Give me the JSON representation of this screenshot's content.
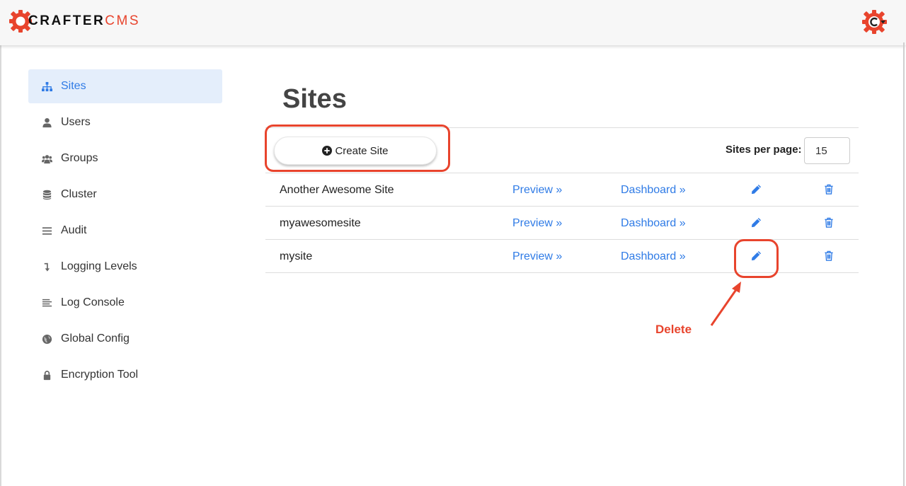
{
  "app": {
    "logo_text_a": "CRAFTER",
    "logo_text_b": "CMS",
    "brand_color": "#e8442d",
    "accent_color": "#2f7be6"
  },
  "sidebar": {
    "items": [
      {
        "label": "Sites",
        "icon": "sitemap-icon",
        "active": true
      },
      {
        "label": "Users",
        "icon": "user-icon",
        "active": false
      },
      {
        "label": "Groups",
        "icon": "users-icon",
        "active": false
      },
      {
        "label": "Cluster",
        "icon": "database-icon",
        "active": false
      },
      {
        "label": "Audit",
        "icon": "list-icon",
        "active": false
      },
      {
        "label": "Logging Levels",
        "icon": "level-down-icon",
        "active": false
      },
      {
        "label": "Log Console",
        "icon": "align-left-icon",
        "active": false
      },
      {
        "label": "Global Config",
        "icon": "globe-icon",
        "active": false
      },
      {
        "label": "Encryption Tool",
        "icon": "lock-icon",
        "active": false
      }
    ]
  },
  "main": {
    "title": "Sites",
    "create_label": "Create Site",
    "per_page_label": "Sites per page:",
    "per_page_value": "15"
  },
  "sites": [
    {
      "name": "Another Awesome Site",
      "preview": "Preview »",
      "dashboard": "Dashboard »"
    },
    {
      "name": "myawesomesite",
      "preview": "Preview »",
      "dashboard": "Dashboard »"
    },
    {
      "name": "mysite",
      "preview": "Preview »",
      "dashboard": "Dashboard »"
    }
  ],
  "annotation": {
    "label": "Delete"
  }
}
